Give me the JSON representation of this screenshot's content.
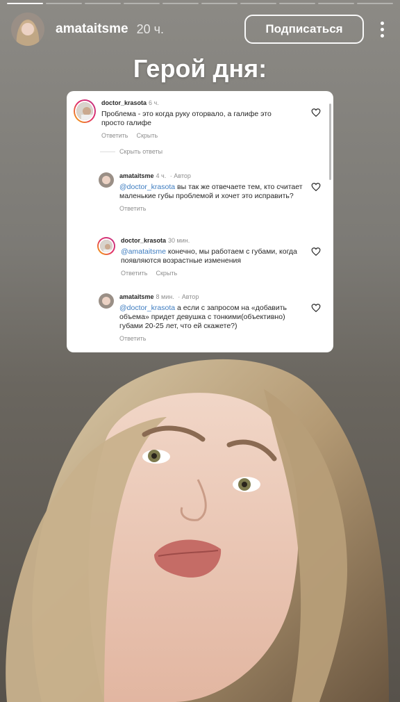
{
  "story": {
    "progress_total": 10,
    "progress_done": 1,
    "username": "amataitsme",
    "time": "20 ч.",
    "follow_label": "Подписаться",
    "title": "Герой дня:"
  },
  "comments": [
    {
      "user": "doctor_krasota",
      "time": "6 ч.",
      "author_tag": "",
      "mention": "",
      "text": "Проблема - это когда руку оторвало, а галифе это просто галифе",
      "reply_label": "Ответить",
      "hide_label": "Скрыть"
    },
    {
      "user": "amataitsme",
      "time": "4 ч.",
      "author_tag": "· Автор",
      "mention": "@doctor_krasota",
      "text": " вы так же отвечаете тем, кто считает маленькие губы проблемой и хочет это исправить?",
      "reply_label": "Ответить",
      "hide_label": ""
    },
    {
      "user": "doctor_krasota",
      "time": "30 мин.",
      "author_tag": "",
      "mention": "@amataitsme",
      "text": " конечно, мы работаем с губами, когда появляются возрастные изменения",
      "reply_label": "Ответить",
      "hide_label": "Скрыть"
    },
    {
      "user": "amataitsme",
      "time": "8 мин.",
      "author_tag": "· Автор",
      "mention": "@doctor_krasota",
      "text": " а если с запросом на «добавить объема» придет девушка с тонкими(объективно) губами 20-25 лет, что ей скажете?)",
      "reply_label": "Ответить",
      "hide_label": ""
    }
  ],
  "hide_replies_label": "Скрыть ответы",
  "icons": {
    "more": "more-vertical-icon",
    "heart": "heart-outline-icon"
  },
  "colors": {
    "mention": "#3c7bbf",
    "secondary": "#8e8e8e"
  }
}
